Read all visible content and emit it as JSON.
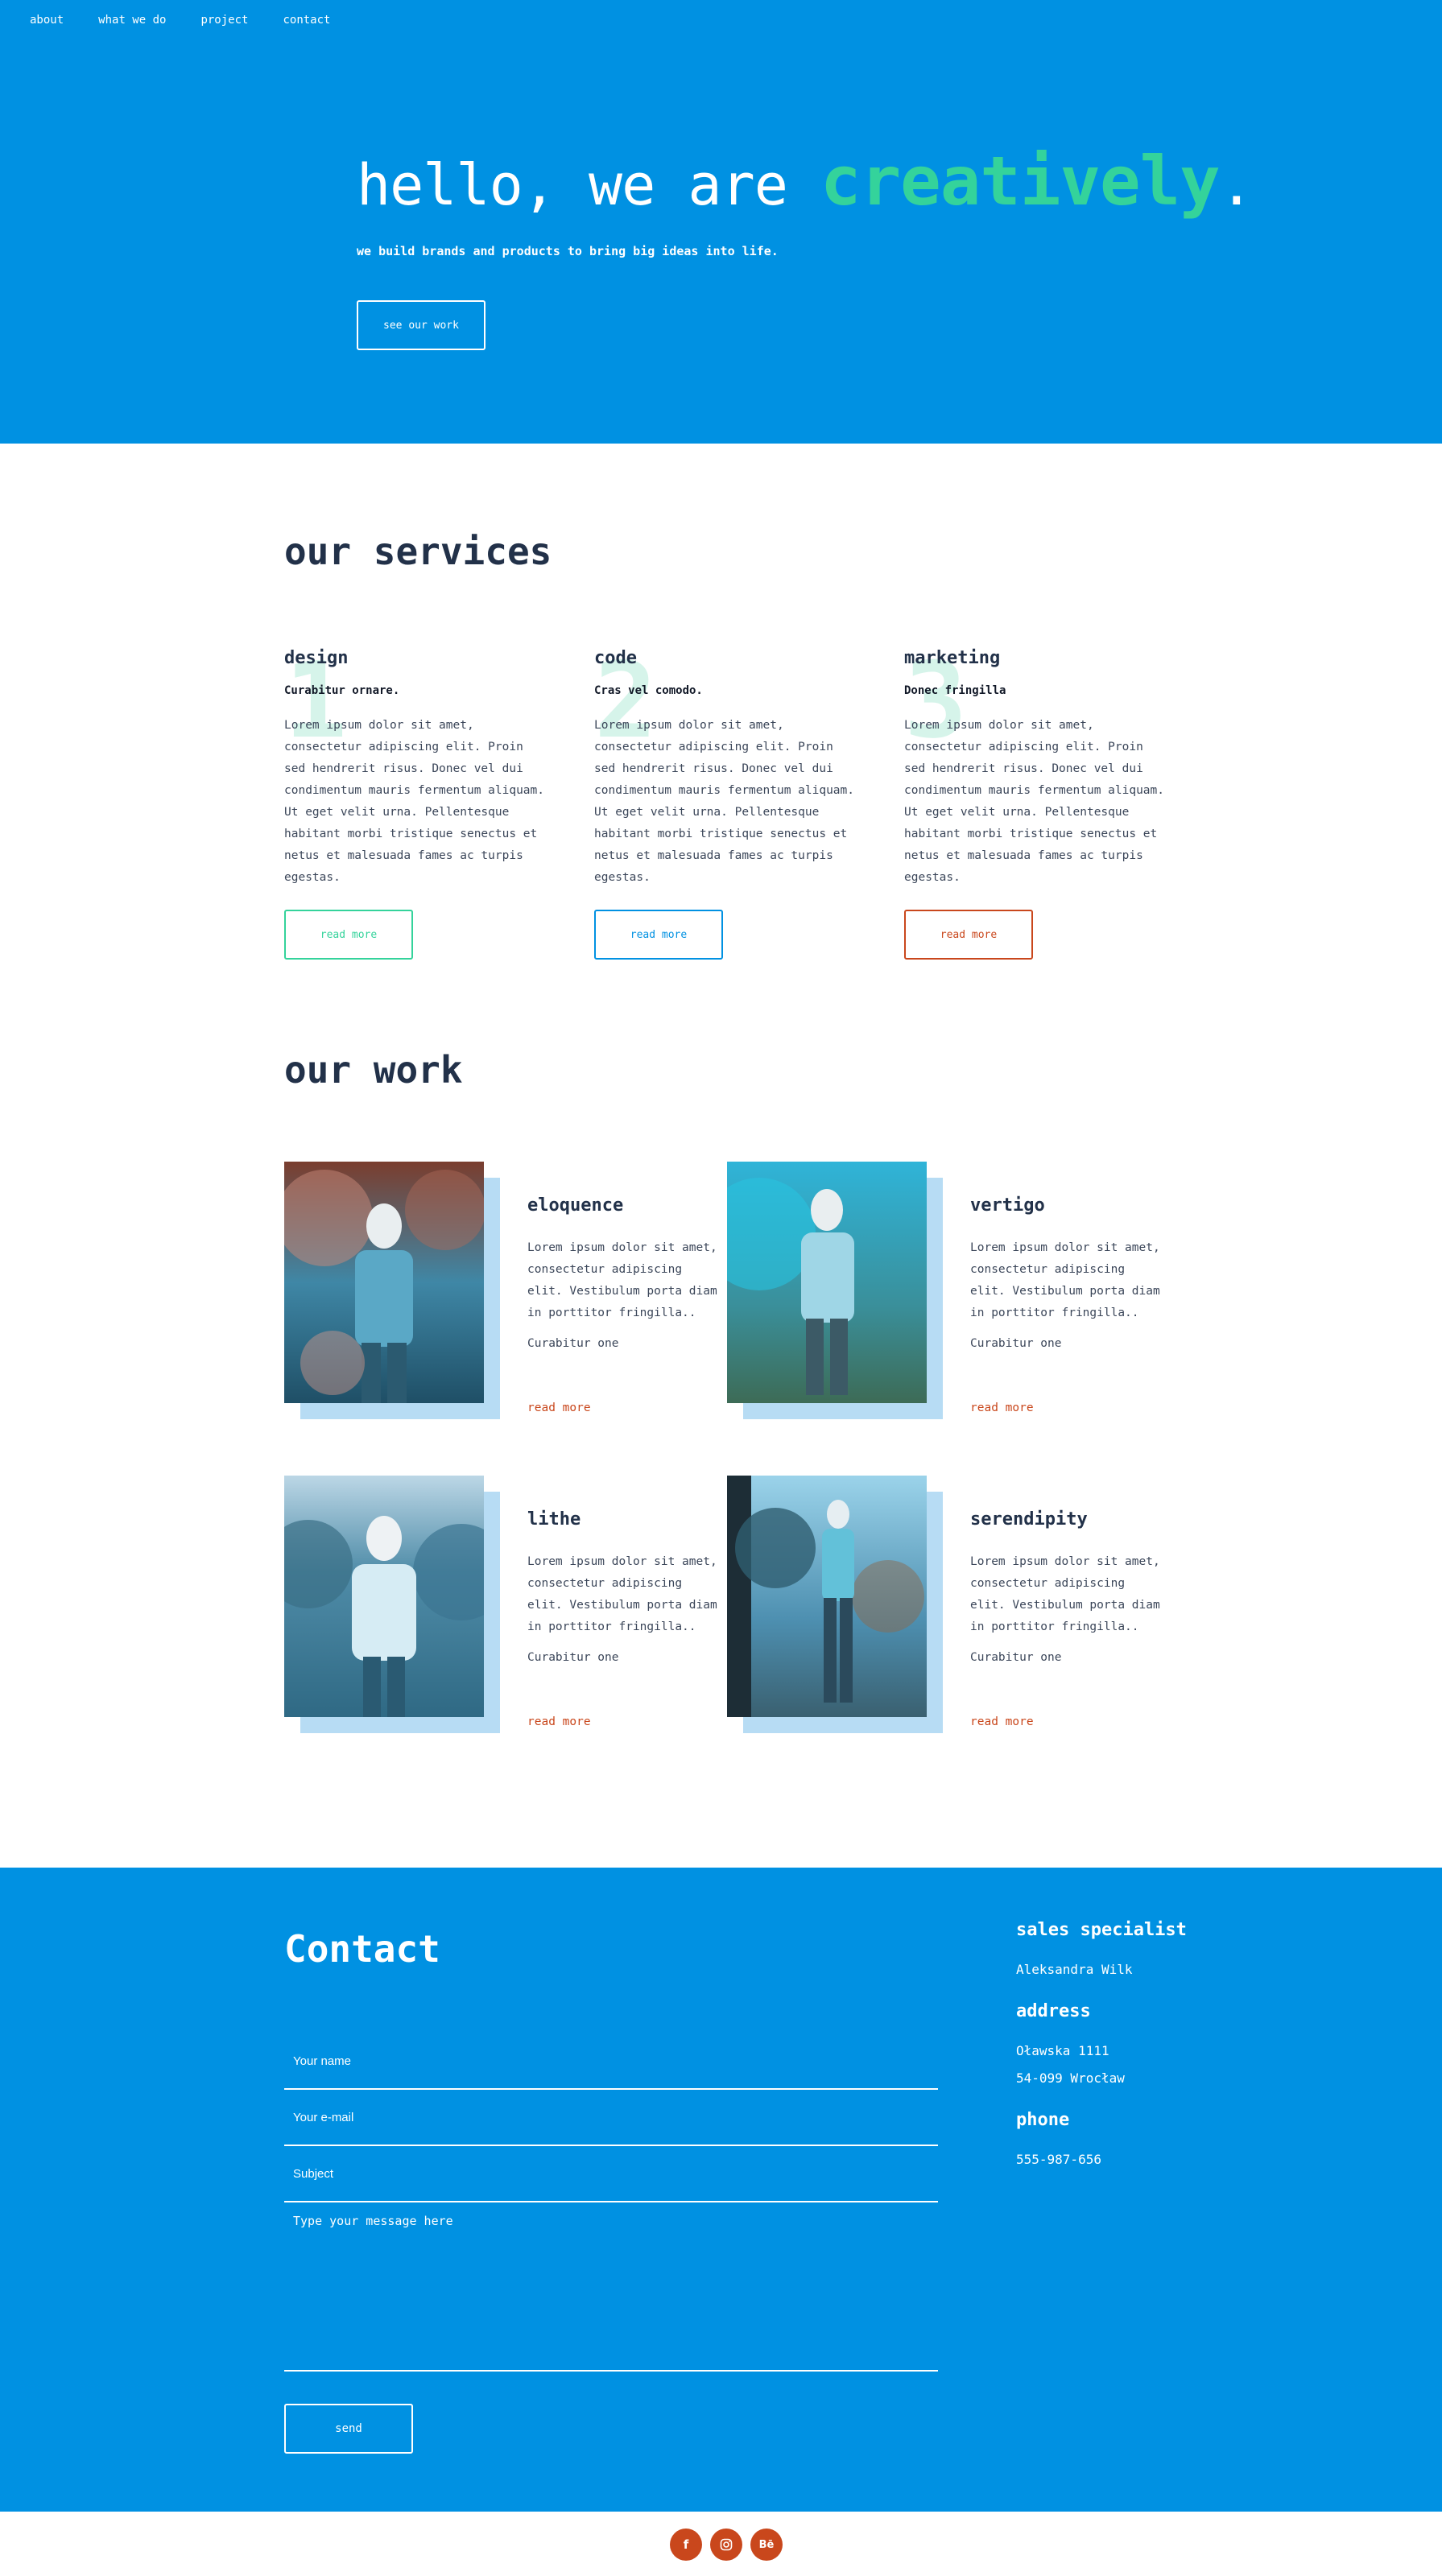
{
  "nav": {
    "items": [
      "about",
      "what we do",
      "project",
      "contact"
    ]
  },
  "hero": {
    "title_prefix": "hello, we are ",
    "title_accent": "creatively",
    "title_suffix": ".",
    "subtitle": "we build brands and products to bring big ideas into life.",
    "button": "see our work"
  },
  "services": {
    "heading": "our services",
    "items": [
      {
        "number": "1",
        "title": "design",
        "lead": "Curabitur ornare.",
        "body": "Lorem ipsum dolor sit amet, consectetur adipiscing elit. Proin sed hendrerit risus. Donec vel dui condimentum mauris fermentum aliquam. Ut eget velit urna. Pellentesque habitant morbi tristique senectus et netus et malesuada fames ac turpis egestas.",
        "button": "read more",
        "color": "#34d39b"
      },
      {
        "number": "2",
        "title": "code",
        "lead": "Cras vel comodo.",
        "body": "Lorem ipsum dolor sit amet, consectetur adipiscing elit. Proin sed hendrerit risus. Donec vel dui condimentum mauris fermentum aliquam. Ut eget velit urna. Pellentesque habitant morbi tristique senectus et netus et malesuada fames ac turpis egestas.",
        "button": "read more",
        "color": "#0091e2"
      },
      {
        "number": "3",
        "title": "marketing",
        "lead": "Donec fringilla",
        "body": "Lorem ipsum dolor sit amet, consectetur adipiscing elit. Proin sed hendrerit risus. Donec vel dui condimentum mauris fermentum aliquam. Ut eget velit urna. Pellentesque habitant morbi tristique senectus et netus et malesuada fames ac turpis egestas.",
        "button": "read more",
        "color": "#c9471c"
      }
    ]
  },
  "work": {
    "heading": "our work",
    "items": [
      {
        "title": "eloquence",
        "desc": "Lorem ipsum dolor sit amet, consectetur adipiscing elit. Vestibulum porta diam in porttitor fringilla..",
        "meta": "Curabitur one",
        "more": "read more"
      },
      {
        "title": "vertigo",
        "desc": "Lorem ipsum dolor sit amet, consectetur adipiscing elit. Vestibulum porta diam in porttitor fringilla..",
        "meta": "Curabitur one",
        "more": "read more"
      },
      {
        "title": "lithe",
        "desc": "Lorem ipsum dolor sit amet, consectetur adipiscing elit. Vestibulum porta diam in porttitor fringilla..",
        "meta": "Curabitur one",
        "more": "read more"
      },
      {
        "title": "serendipity",
        "desc": "Lorem ipsum dolor sit amet, consectetur adipiscing elit. Vestibulum porta diam in porttitor fringilla..",
        "meta": "Curabitur one",
        "more": "read more"
      }
    ]
  },
  "contact": {
    "heading": "Contact",
    "name_placeholder": "Your name",
    "email_placeholder": "Your e-mail",
    "subject_placeholder": "Subject",
    "message_placeholder": "Type your message here",
    "send": "send",
    "sales_heading": "sales specialist",
    "sales_name": "Aleksandra Wilk",
    "address_heading": "address",
    "address_line1": "Oławska 1111",
    "address_line2": "54-099 Wrocław",
    "phone_heading": "phone",
    "phone": "555-987-656"
  },
  "social": {
    "items": [
      "facebook-icon",
      "instagram-icon",
      "behance-icon"
    ],
    "behance_label": "Bē",
    "color": "#c9471c"
  },
  "colors": {
    "brand_blue": "#0091e2",
    "accent_green": "#34d39b",
    "accent_orange": "#c9471c",
    "dark_text": "#223149"
  }
}
